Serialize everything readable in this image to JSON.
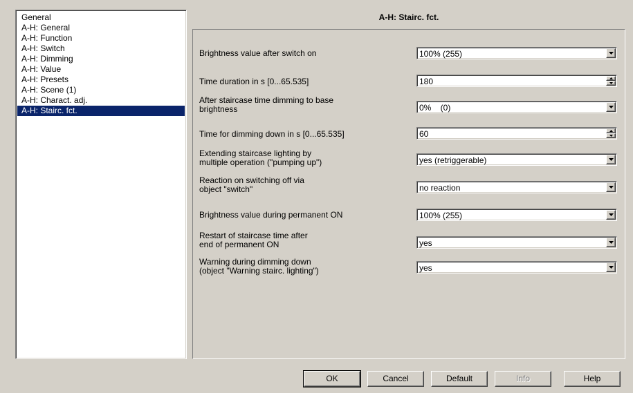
{
  "nav": {
    "items": [
      {
        "label": "General",
        "selected": false
      },
      {
        "label": "A-H: General",
        "selected": false
      },
      {
        "label": "A-H: Function",
        "selected": false
      },
      {
        "label": "A-H: Switch",
        "selected": false
      },
      {
        "label": "A-H: Dimming",
        "selected": false
      },
      {
        "label": "A-H: Value",
        "selected": false
      },
      {
        "label": "A-H: Presets",
        "selected": false
      },
      {
        "label": "A-H: Scene (1)",
        "selected": false
      },
      {
        "label": "A-H: Charact. adj.",
        "selected": false
      },
      {
        "label": "A-H: Stairc. fct.",
        "selected": true
      }
    ]
  },
  "page": {
    "title": "A-H: Stairc. fct."
  },
  "params": [
    {
      "label": "Brightness value after switch on",
      "value": "100% (255)",
      "control": "combo"
    },
    {
      "label": "Time duration in s [0...65.535]",
      "value": "180",
      "control": "spin"
    },
    {
      "label": "After staircase time dimming to base\nbrightness",
      "value": "0%    (0)",
      "control": "combo"
    },
    {
      "label": "Time for dimming down in s [0...65.535]",
      "value": "60",
      "control": "spin"
    },
    {
      "label": "Extending staircase lighting by\nmultiple operation (\"pumping up\")",
      "value": "yes (retriggerable)",
      "control": "combo"
    },
    {
      "label": "Reaction on switching off via\nobject \"switch\"",
      "value": "no reaction",
      "control": "combo"
    },
    {
      "label": "Brightness value during permanent ON",
      "value": "100% (255)",
      "control": "combo"
    },
    {
      "label": "Restart of staircase time after\nend of permanent ON",
      "value": "yes",
      "control": "combo"
    },
    {
      "label": "Warning during dimming down\n(object \"Warning stairc. lighting\")",
      "value": "yes",
      "control": "combo"
    }
  ],
  "buttons": {
    "ok": "OK",
    "cancel": "Cancel",
    "default": "Default",
    "info": "Info",
    "help": "Help"
  },
  "icons": {
    "dropdown": "chevron-down-icon",
    "spin_up": "arrow-up-icon",
    "spin_down": "arrow-down-icon"
  }
}
